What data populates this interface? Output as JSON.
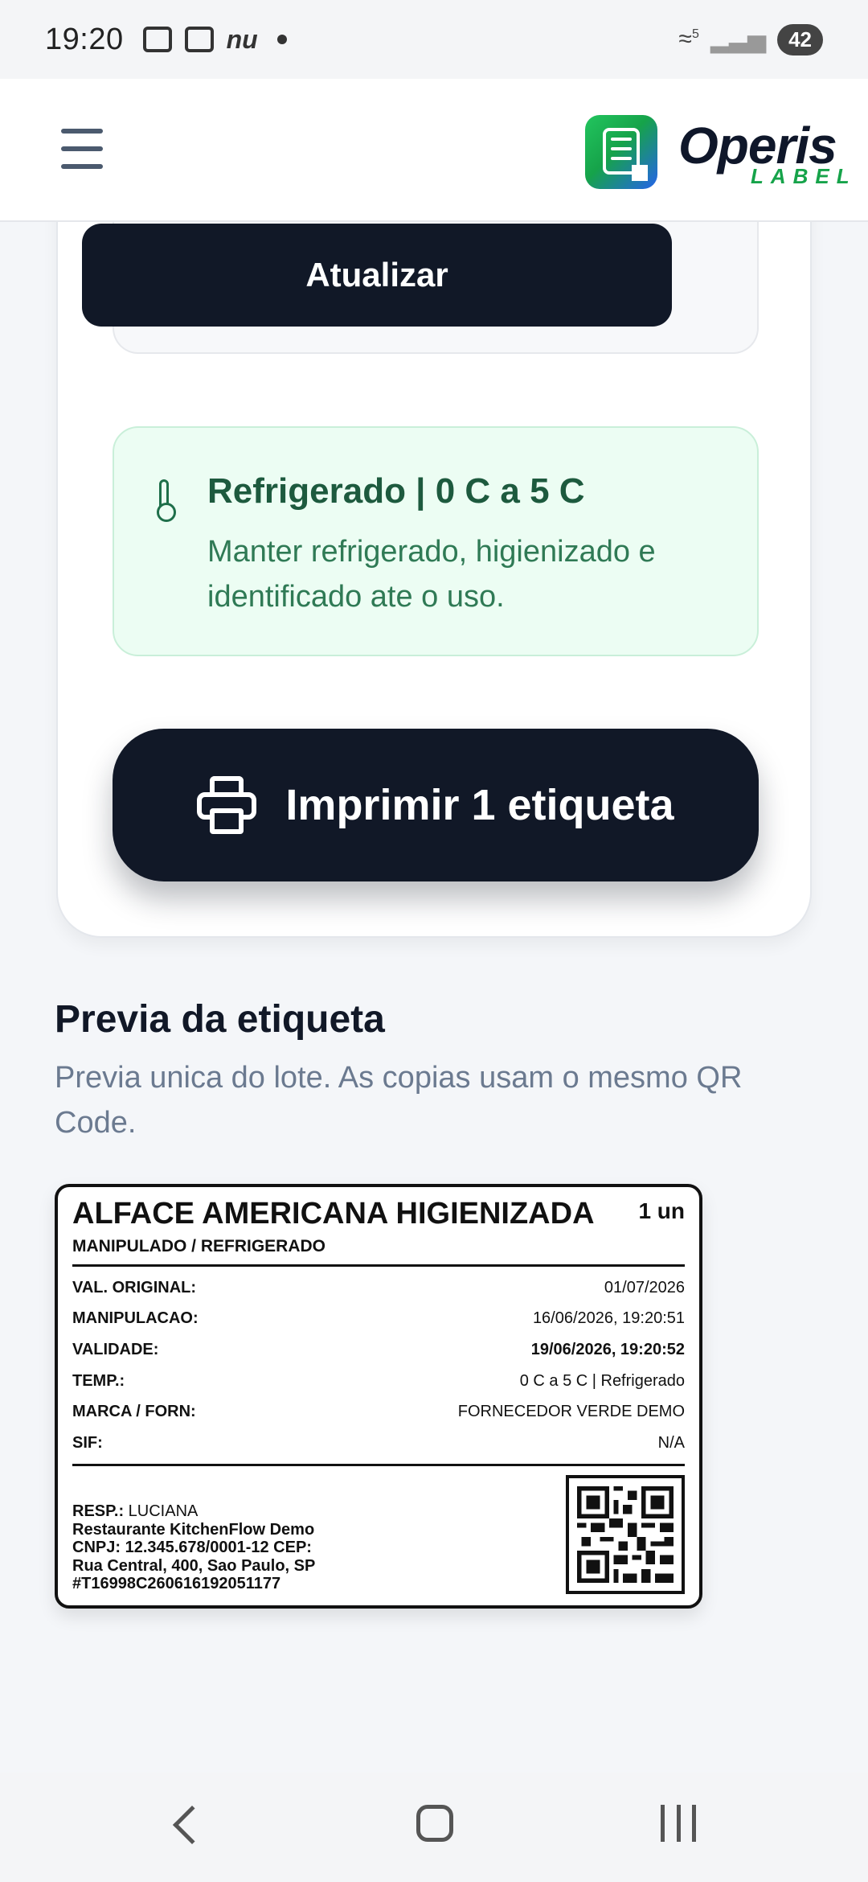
{
  "status_bar": {
    "time": "19:20",
    "carrier_badge": "nu",
    "battery": "42",
    "wifi_label": "5"
  },
  "header": {
    "menu_icon": "hamburger-menu-icon",
    "logo_word": "Operis",
    "logo_sub": "LABEL"
  },
  "form": {
    "update_label": "Atualizar"
  },
  "storage": {
    "title": "Refrigerado | 0 C a 5 C",
    "description": "Manter refrigerado, higienizado e identificado ate o uso."
  },
  "print_button": {
    "label": "Imprimir 1 etiqueta"
  },
  "preview": {
    "title": "Previa da etiqueta",
    "subtitle": "Previa unica do lote. As copias usam o mesmo QR Code."
  },
  "label": {
    "product": "ALFACE AMERICANA HIGIENIZADA",
    "quantity": "1 un",
    "kind": "MANIPULADO / REFRIGERADO",
    "rows": [
      {
        "key": "VAL. ORIGINAL:",
        "value": "01/07/2026"
      },
      {
        "key": "MANIPULACAO:",
        "value": "16/06/2026, 19:20:51"
      },
      {
        "key": "VALIDADE:",
        "value": "19/06/2026, 19:20:52"
      },
      {
        "key": "TEMP.:",
        "value": "0 C a 5 C | Refrigerado"
      },
      {
        "key": "MARCA / FORN:",
        "value": "FORNECEDOR VERDE DEMO"
      },
      {
        "key": "SIF:",
        "value": "N/A"
      }
    ],
    "resp_label": "RESP.:",
    "resp_name": "LUCIANA",
    "restaurant": "Restaurante KitchenFlow Demo",
    "cnpj_line": "CNPJ: 12.345.678/0001-12 CEP:",
    "address": "Rua Central, 400, Sao Paulo, SP",
    "code": "#T16998C260616192051177"
  }
}
